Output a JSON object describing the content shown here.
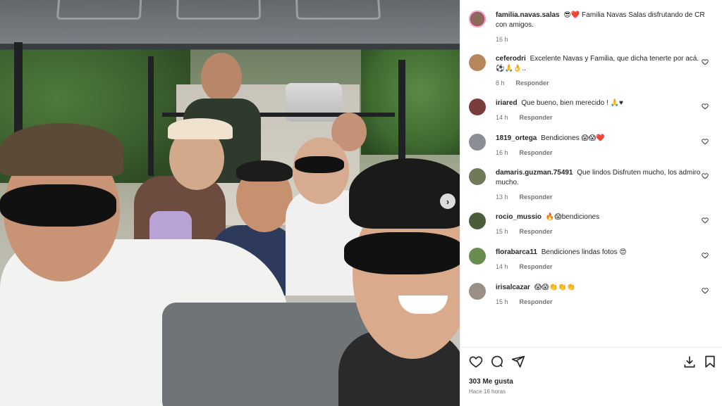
{
  "photo": {
    "next_icon": "chevron-right-icon"
  },
  "post": {
    "author": "familia.navas.salas",
    "caption": "😎❤️ Familia Navas Salas disfrutando de CR con amigos.",
    "time": "16 h"
  },
  "comments": [
    {
      "user": "ceferodri",
      "text": "Excelente Navas y Familia, que dicha tenerte por acá. ⚽🙏👌..",
      "time": "8 h",
      "reply": "Responder",
      "avatar_color": "#b8865b"
    },
    {
      "user": "iriared",
      "text": "Que bueno, bien merecido ! 🙏♥",
      "time": "14 h",
      "reply": "Responder",
      "avatar_color": "#7a3b3b"
    },
    {
      "user": "1819_ortega",
      "text": "Bendiciones 😱😱❤️",
      "time": "16 h",
      "reply": "Responder",
      "avatar_color": "#8b8f95"
    },
    {
      "user": "damaris.guzman.75491",
      "text": "Que lindos Disfruten mucho, los admiro mucho.",
      "time": "13 h",
      "reply": "Responder",
      "avatar_color": "#6d7b5a"
    },
    {
      "user": "rocio_mussio",
      "text": "🔥😱bendiciones",
      "time": "15 h",
      "reply": "Responder",
      "avatar_color": "#4a5d3a"
    },
    {
      "user": "florabarca11",
      "text": "Bendiciones lindas fotos 😍",
      "time": "14 h",
      "reply": "Responder",
      "avatar_color": "#6a8c4e"
    },
    {
      "user": "irisalcazar",
      "text": "😱😱👏👏👏",
      "time": "15 h",
      "reply": "Responder",
      "avatar_color": "#9a8f84"
    }
  ],
  "actions": {
    "like_icon": "heart-outline-icon",
    "comment_icon": "comment-icon",
    "share_icon": "send-icon",
    "download_icon": "download-icon",
    "save_icon": "bookmark-icon"
  },
  "likes": "303 Me gusta",
  "posted_ago": "Hace 16 horas"
}
